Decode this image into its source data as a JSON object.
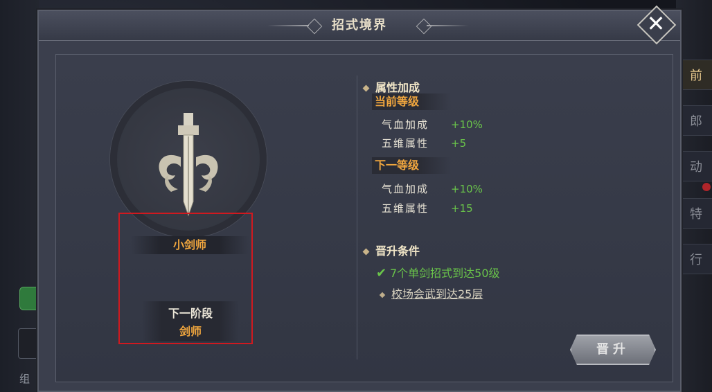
{
  "dialog": {
    "title": "招式境界",
    "close_label": "✕"
  },
  "emblem": {
    "icon": "sword-icon",
    "rank_name": "小剑师",
    "next_stage_title": "下一阶段",
    "next_stage_name": "剑师"
  },
  "attributes": {
    "heading": "属性加成",
    "current": {
      "label": "当前等级",
      "stats": [
        {
          "name": "气血加成",
          "value": "+10%"
        },
        {
          "name": "五维属性",
          "value": "+5"
        }
      ]
    },
    "next": {
      "label": "下一等级",
      "stats": [
        {
          "name": "气血加成",
          "value": "+10%"
        },
        {
          "name": "五维属性",
          "value": "+15"
        }
      ]
    }
  },
  "promotion": {
    "heading": "晋升条件",
    "conditions": [
      {
        "text": "7个单剑招式到达50级",
        "done": true
      },
      {
        "text": "校场会武到达25层",
        "done": false
      }
    ],
    "button_label": "晋升"
  },
  "background": {
    "right_tabs": [
      "前",
      "郎",
      "动",
      "特",
      "行"
    ],
    "left_text": "组"
  },
  "colors": {
    "accent_orange": "#f0a63e",
    "positive_green": "#6ac54a",
    "highlight_red": "#d0191f"
  }
}
